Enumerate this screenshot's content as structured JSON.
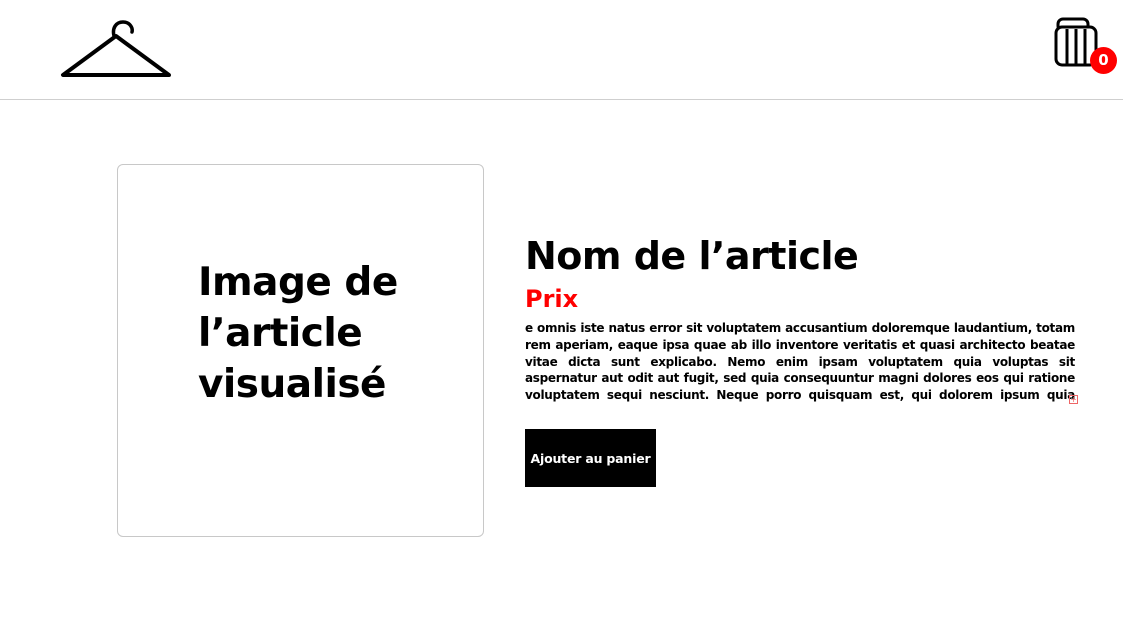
{
  "header": {
    "logo_icon": "hanger-icon",
    "cart": {
      "icon": "cart-icon",
      "count": "0",
      "badge_color": "#ff0000"
    }
  },
  "product": {
    "image_placeholder": "Image de l’article visualisé",
    "name": "Nom de l’article",
    "price": "Prix",
    "price_color": "#ff0000",
    "description": "e omnis iste natus error sit voluptatem accusantium doloremque laudantium, totam rem aperiam, eaque ipsa quae ab illo inventore veritatis et quasi architecto beatae vitae dicta sunt explicabo. Nemo enim ipsam voluptatem quia voluptas sit aspernatur aut odit aut fugit, sed quia consequuntur magni dolores eos qui ratione voluptatem sequi nesciunt. Neque porro quisquam est, qui dolorem ipsum quia dolor",
    "expand_icon": "expand-icon",
    "add_to_cart_label": "Ajouter au panier"
  }
}
